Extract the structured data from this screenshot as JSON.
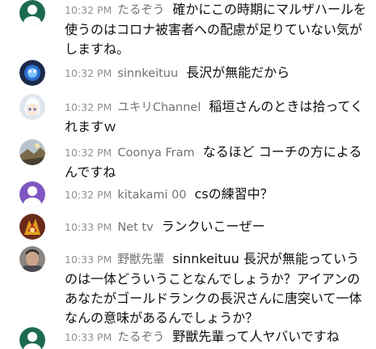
{
  "messages": [
    {
      "time": "10:32 PM",
      "author": "たるぞう",
      "text": "確かにこの時期にマルザハールを使うのはコロナ被害者への配慮が足りていない気がしますね。",
      "avatar": "default-avatar-icon",
      "avatar_color": "#1d6b4f"
    },
    {
      "time": "10:32 PM",
      "author": "sinnkeituu",
      "text": "長沢が無能だから",
      "avatar": "blue-orb-avatar",
      "avatar_color": "#1b2a4a"
    },
    {
      "time": "10:32 PM",
      "author": "ユキリChannel",
      "text": "稲垣さんのときは拾ってくれますｗ",
      "avatar": "anime-girl-avatar",
      "avatar_color": "#dfe6ee"
    },
    {
      "time": "10:32 PM",
      "author": "Coonya Fram",
      "text": "なるほど コーチの方によるんですね",
      "avatar": "landscape-avatar",
      "avatar_color": "#9a8a6a"
    },
    {
      "time": "10:32 PM",
      "author": "kitakami 00",
      "text": "csの練習中？",
      "avatar": "default-avatar-icon",
      "avatar_color": "#7e57c2"
    },
    {
      "time": "10:33 PM",
      "author": "Net tv",
      "text": "ランクいこーぜー",
      "avatar": "game-character-avatar",
      "avatar_color": "#6a2a1a"
    },
    {
      "time": "10:33 PM",
      "author": "野獣先輩",
      "text": "sinnkeituu 長沢が無能っていうのは一体どういうことなんでしょうか？アイアンのあなたがゴールドランクの長沢さんに唐突いて一体なんの意味があるんでしょうか？",
      "avatar": "man-photo-avatar",
      "avatar_color": "#5f5a55"
    },
    {
      "time": "10:33 PM",
      "author": "たるぞう",
      "text": "野獣先輩って人ヤバいですね",
      "avatar": "default-avatar-icon",
      "avatar_color": "#1d6b4f"
    }
  ]
}
